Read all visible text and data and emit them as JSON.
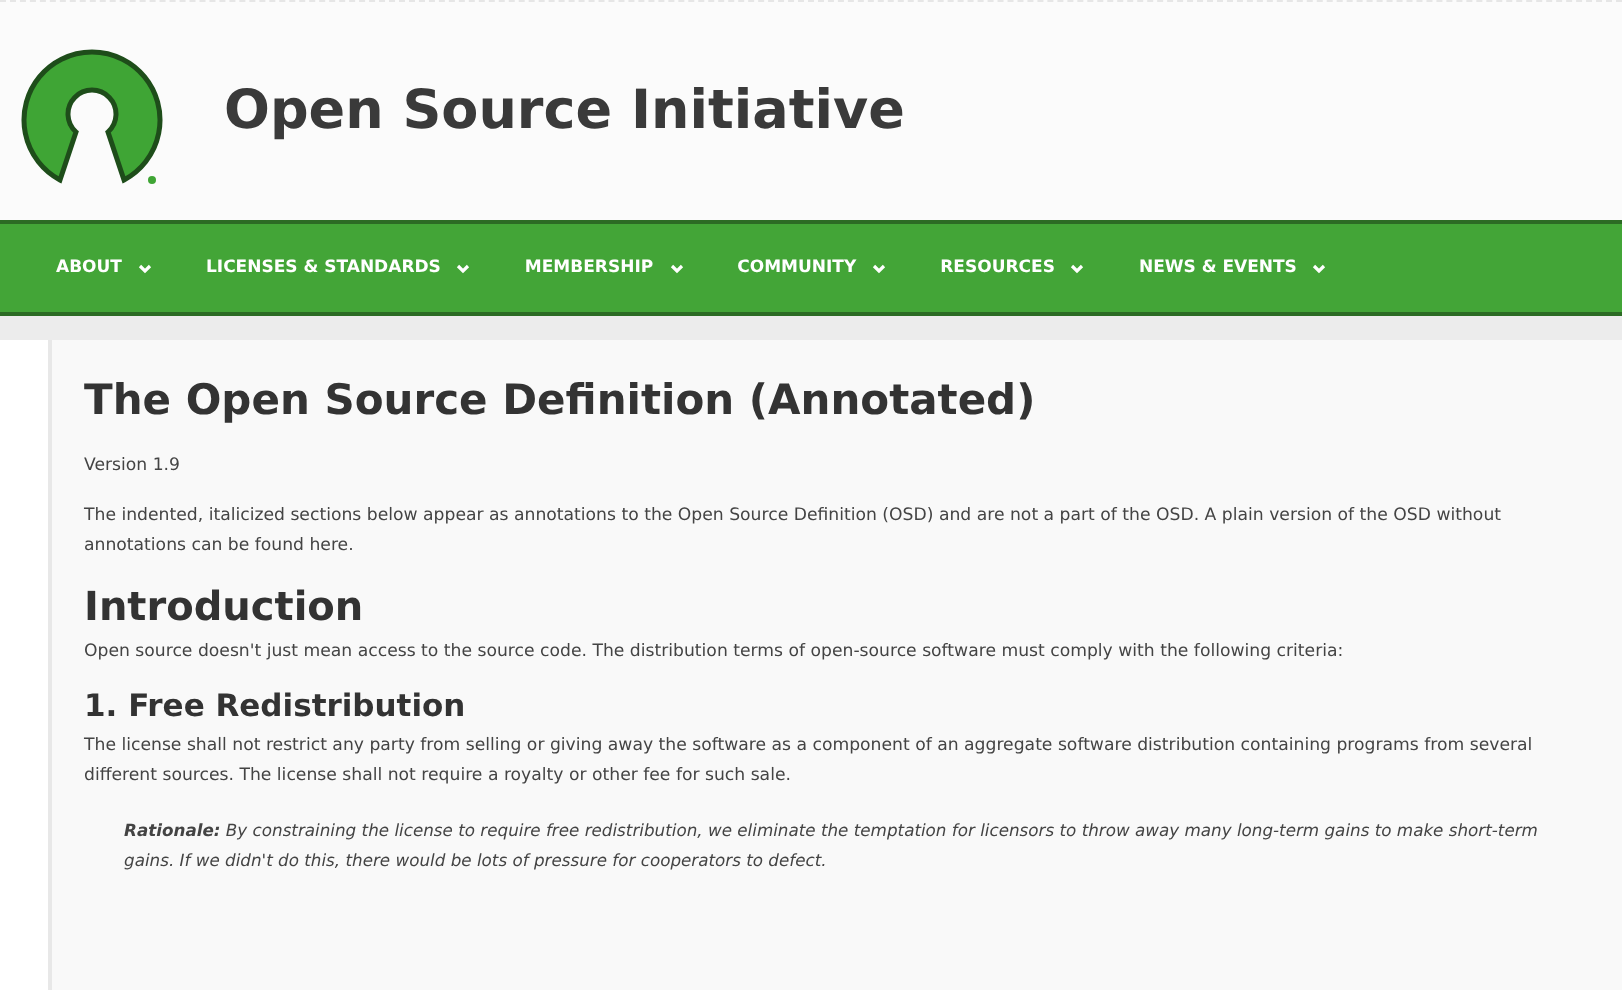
{
  "site": {
    "title": "Open Source Initiative"
  },
  "nav": [
    {
      "label": "ABOUT"
    },
    {
      "label": "LICENSES & STANDARDS"
    },
    {
      "label": "MEMBERSHIP"
    },
    {
      "label": "COMMUNITY"
    },
    {
      "label": "RESOURCES"
    },
    {
      "label": "NEWS & EVENTS"
    }
  ],
  "page": {
    "title": "The Open Source Definition (Annotated)",
    "version": "Version 1.9",
    "note": {
      "text_before": "The indented, italicized sections below appear as annotations to the Open Source Definition (OSD) and are not a part of the OSD. A plain version of the OSD without annotations can be found ",
      "link": "here",
      "text_after": "."
    },
    "sections": [
      {
        "kind": "h2",
        "heading": "Introduction",
        "paragraphs": [
          {
            "kind": "body",
            "text": "Open source doesn't just mean access to the source code. The distribution terms of open-source software must comply with the following criteria:"
          }
        ]
      },
      {
        "kind": "h3",
        "heading": "1. Free Redistribution",
        "paragraphs": [
          {
            "kind": "body",
            "text": "The license shall not restrict any party from selling or giving away the software as a component of an aggregate software distribution containing programs from several different sources. The license shall not require a royalty or other fee for such sale."
          },
          {
            "kind": "annotation",
            "text": "**Rationale:** By constraining the license to require free redistribution, we eliminate the temptation for licensors to throw away many long-term gains to make short-term gains. If we didn't do this, there would be lots of pressure for cooperators to defect."
          }
        ]
      }
    ]
  }
}
